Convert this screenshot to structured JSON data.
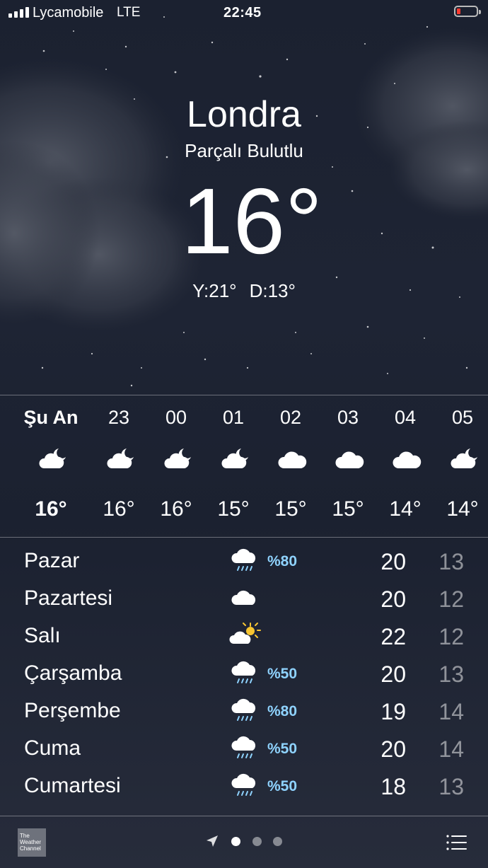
{
  "status_bar": {
    "carrier": "Lycamobile",
    "network": "LTE",
    "time": "22:45"
  },
  "current": {
    "city": "Londra",
    "condition": "Parçalı Bulutlu",
    "temperature": "16°",
    "high": "Y:21°",
    "low": "D:13°"
  },
  "hourly": [
    {
      "label": "Şu An",
      "icon": "partly-cloudy-night-icon",
      "temp": "16°"
    },
    {
      "label": "23",
      "icon": "partly-cloudy-night-icon",
      "temp": "16°"
    },
    {
      "label": "00",
      "icon": "partly-cloudy-night-icon",
      "temp": "16°"
    },
    {
      "label": "01",
      "icon": "partly-cloudy-night-icon",
      "temp": "15°"
    },
    {
      "label": "02",
      "icon": "cloud-icon",
      "temp": "15°"
    },
    {
      "label": "03",
      "icon": "cloud-icon",
      "temp": "15°"
    },
    {
      "label": "04",
      "icon": "cloud-icon",
      "temp": "14°"
    },
    {
      "label": "05",
      "icon": "partly-cloudy-night-icon",
      "temp": "14°"
    }
  ],
  "daily": [
    {
      "day": "Pazar",
      "icon": "rain-icon",
      "precip": "%80",
      "high": "20",
      "low": "13"
    },
    {
      "day": "Pazartesi",
      "icon": "cloud-icon",
      "precip": "",
      "high": "20",
      "low": "12"
    },
    {
      "day": "Salı",
      "icon": "partly-sunny-icon",
      "precip": "",
      "high": "22",
      "low": "12"
    },
    {
      "day": "Çarşamba",
      "icon": "rain-icon",
      "precip": "%50",
      "high": "20",
      "low": "13"
    },
    {
      "day": "Perşembe",
      "icon": "rain-icon",
      "precip": "%80",
      "high": "19",
      "low": "14"
    },
    {
      "day": "Cuma",
      "icon": "rain-icon",
      "precip": "%50",
      "high": "20",
      "low": "14"
    },
    {
      "day": "Cumartesi",
      "icon": "rain-icon",
      "precip": "%50",
      "high": "18",
      "low": "13"
    }
  ],
  "footer": {
    "logo_text": [
      "The",
      "Weather",
      "Channel"
    ],
    "page_count": 3,
    "active_page": 0
  },
  "colors": {
    "precip": "#8fd3ff",
    "battery_low": "#ff3b30",
    "sun": "#f7c531"
  }
}
